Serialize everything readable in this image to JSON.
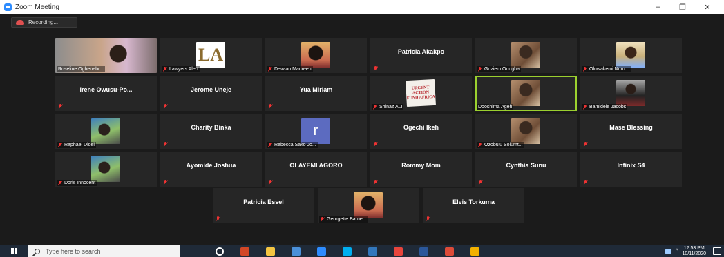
{
  "window": {
    "title": "Zoom Meeting",
    "minimize": "–",
    "maximize": "❐",
    "close": "✕"
  },
  "recording": {
    "label": "Recording..."
  },
  "participants": [
    {
      "label": "Roseline Oghenebr...",
      "video": "wide photo"
    },
    {
      "label": "Lawyers Alert",
      "video": "square logo-la",
      "logo_text": "LA"
    },
    {
      "label": "Devaan Maureen",
      "video": "square portrait"
    },
    {
      "center": "Patricia Akakpo"
    },
    {
      "label": "Goziem Onugha",
      "video": "square photo"
    },
    {
      "label": "Oluwakemi Nuru...",
      "video": "square bride"
    },
    {
      "center": "Irene  Owusu-Po..."
    },
    {
      "center": "Jerome Uneje"
    },
    {
      "center": "Yua Miriam"
    },
    {
      "label": "Shinaz ALI",
      "video": "square logo-urgent",
      "logo_text": "URGENT ACTION FUND AFRICA"
    },
    {
      "label": "Dooshima Ageh",
      "video": "square photo",
      "active": true
    },
    {
      "label": "Bamidele Jacobs",
      "video": "square office"
    },
    {
      "label": "Raphael Didel",
      "video": "square outdoor"
    },
    {
      "center": "Charity Binka"
    },
    {
      "label": "Rebecca Sako Jo...",
      "video": "square avatar-r",
      "logo_text": "r"
    },
    {
      "center": "Ogechi Ikeh"
    },
    {
      "label": "Ozobulu Solumt...",
      "video": "square photo"
    },
    {
      "center": "Mase Blessing"
    },
    {
      "label": "Doris Innocent",
      "video": "square outdoor"
    },
    {
      "center": "Ayomide Joshua"
    },
    {
      "center": "OLAYEMI AGORO"
    },
    {
      "center": "Rommy Mom"
    },
    {
      "center": "Cynthia Sunu"
    },
    {
      "center": "Infinix S4"
    },
    {
      "center": "Patricia Essel"
    },
    {
      "label": "Georgette Barne...",
      "video": "square portrait"
    },
    {
      "center": "Elvis Torkuma"
    }
  ],
  "taskbar": {
    "search_placeholder": "Type here to search",
    "apps": [
      "cortana-icon",
      "powerpoint-icon",
      "file-explorer-icon",
      "mail-icon",
      "zoom-icon",
      "skype-icon",
      "edge-icon",
      "chrome-icon",
      "word-icon",
      "chrome-icon",
      "chrome-icon"
    ],
    "app_colors": [
      "#ffffff",
      "#d24726",
      "#f4c542",
      "#4a90d9",
      "#2d8cff",
      "#00aff0",
      "#3277bc",
      "#e8453c",
      "#2b579a",
      "#dd4b39",
      "#f2b100"
    ],
    "clock_time": "12:53 PM",
    "clock_date": "10/11/2020"
  },
  "colors": {
    "active_speaker": "#9bd02f",
    "tile_bg": "#262626",
    "background": "#1b1b1b"
  }
}
